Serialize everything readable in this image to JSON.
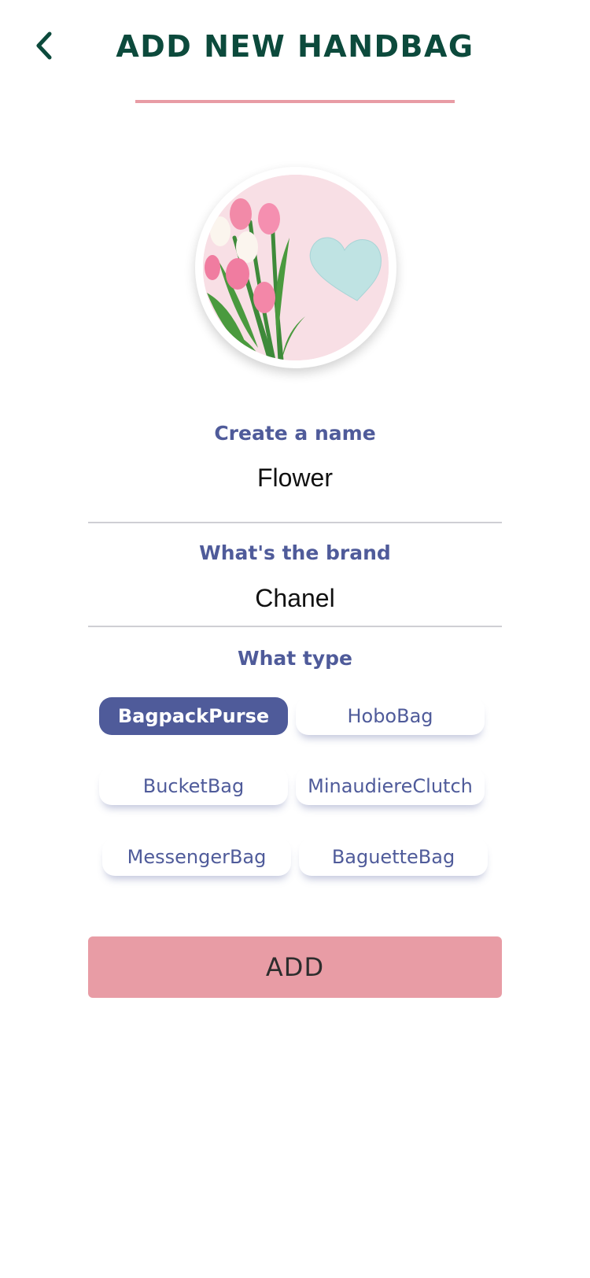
{
  "header": {
    "back_icon": "chevron-left-icon",
    "title": "ADD NEW HANDBAG"
  },
  "photo": {
    "icon": "bag-photo-tulips-heart"
  },
  "form": {
    "name_label": "Create a name",
    "name_value": "Flower",
    "brand_label": "What's the brand",
    "brand_value": "Chanel",
    "type_label": "What type",
    "types": [
      "BagpackPurse",
      "HoboBag",
      "BucketBag",
      "MinaudiereClutch",
      "MessengerBag",
      "BaguetteBag"
    ],
    "selected_type": "BagpackPurse"
  },
  "actions": {
    "add_label": "ADD"
  },
  "colors": {
    "title": "#0c4a3c",
    "accent_pink": "#e89ca5",
    "accent_indigo": "#4f5b9a"
  }
}
